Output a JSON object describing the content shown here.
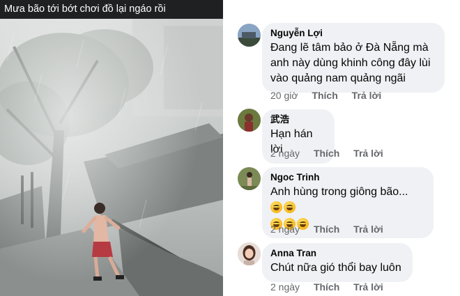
{
  "video": {
    "caption": "Mưa bão tới bớt chơi đồ lại ngáo rồi"
  },
  "comments": [
    {
      "author": "Nguyễn Lợi",
      "lines": [
        "Đang lẽ tâm bảo ở Đà Nẵng mà",
        "anh này dùng khinh công đây lùi",
        "vào quảng nam quảng ngãi"
      ],
      "time": "20 giờ",
      "like": "Thích",
      "reply": "Trả lời"
    },
    {
      "author": "武浩",
      "lines": [
        "Hạn hán lời"
      ],
      "time": "2 ngày",
      "like": "Thích",
      "reply": "Trả lời"
    },
    {
      "author": "Ngoc Trinh",
      "lines": [
        "Anh hùng trong giông bão..."
      ],
      "emoji_name": "rolling-on-floor-laughing-emoji",
      "time": "2 ngày",
      "like": "Thích",
      "reply": "Trả lời"
    },
    {
      "author": "Anna Tran",
      "lines": [
        "Chút nữa gió thổi bay luôn"
      ],
      "time": "2 ngày",
      "like": "Thích",
      "reply": "Trả lời"
    }
  ],
  "colors": {
    "bubble": "#eff1f4",
    "meta_text": "#65676b",
    "caption_bar": "#1f2022"
  }
}
